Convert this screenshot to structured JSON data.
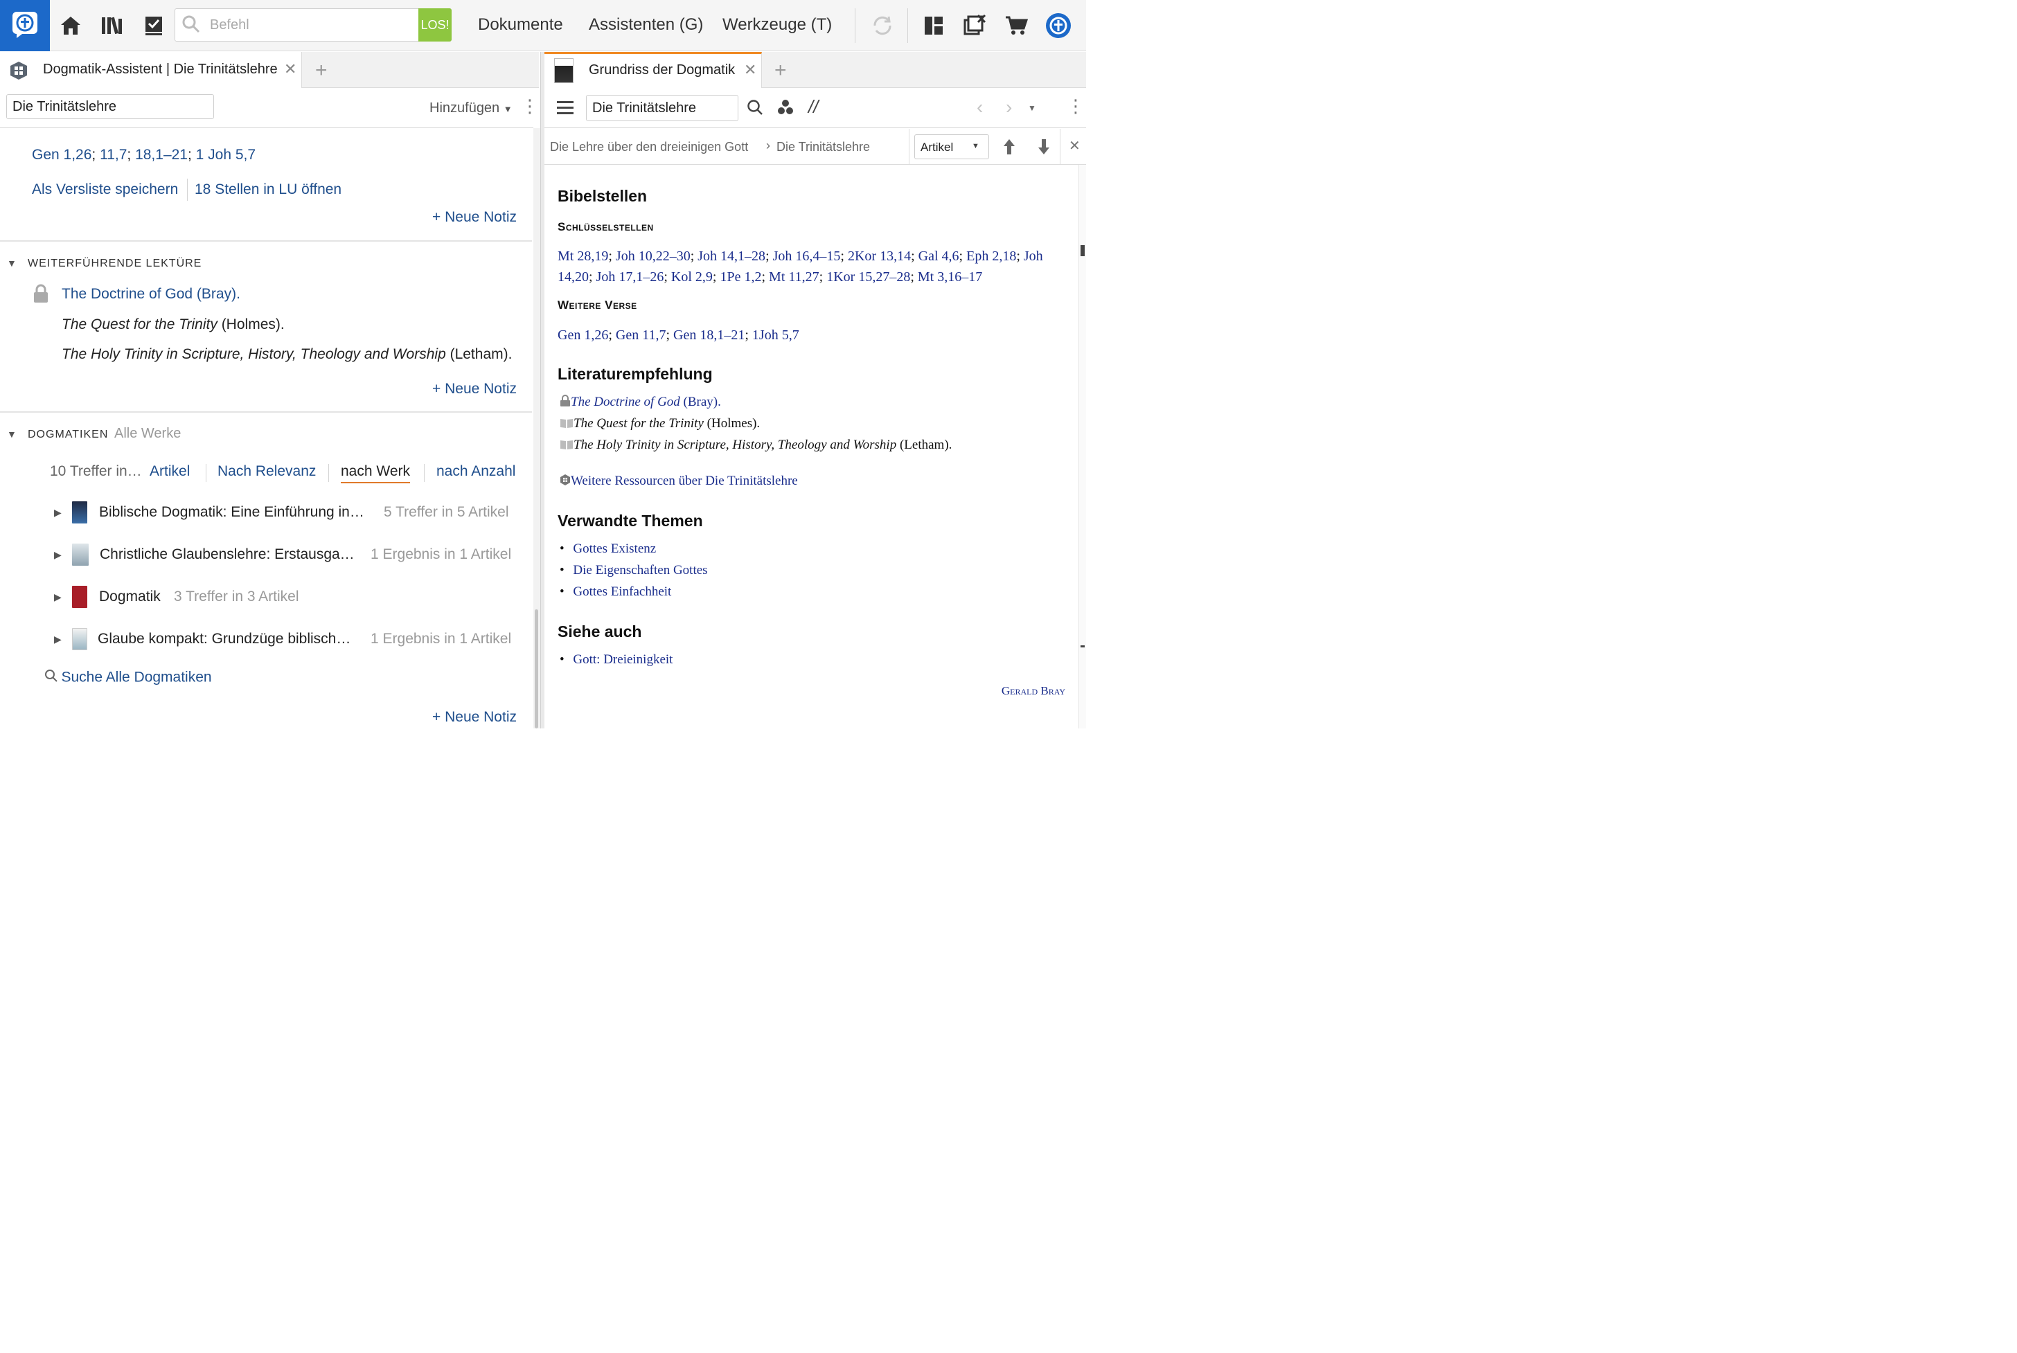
{
  "toolbar": {
    "command_placeholder": "Befehl",
    "go_label": "LOS!",
    "menu": [
      "Dokumente",
      "Assistenten (G)",
      "Werkzeuge (T)"
    ]
  },
  "left_tab": {
    "title": "Dogmatik-Assistent | Die Trinitätslehre"
  },
  "left_toolbar": {
    "topic_value": "Die Trinitätslehre",
    "add_label": "Hinzufügen"
  },
  "verses": {
    "refs": [
      "Gen 1,26",
      "11,7",
      "18,1–21",
      "1 Joh 5,7"
    ],
    "save_label": "Als Versliste speichern",
    "open_label": "18 Stellen in LU öffnen"
  },
  "new_note_label": "+ Neue Notiz",
  "reading": {
    "heading": "WEITERFÜHRENDE LEKTÜRE",
    "items": [
      {
        "title": "The Doctrine of God (Bray).",
        "locked": true
      },
      {
        "title": "The Quest for the Trinity",
        "author": " (Holmes)."
      },
      {
        "title": "The Holy Trinity in Scripture, History, Theology and Worship",
        "author": " (Letham)."
      }
    ]
  },
  "dogmatiken": {
    "heading": "DOGMATIKEN",
    "all_works": "Alle Werke",
    "hits_prefix": "10 Treffer in…",
    "sort_options": [
      "Artikel",
      "Nach Relevanz",
      "nach Werk",
      "nach Anzahl"
    ],
    "rows": [
      {
        "title": "Biblische Dogmatik: Eine Einführung in…",
        "count": "5 Treffer in 5 Artikel"
      },
      {
        "title": "Christliche Glaubenslehre: Erstausga…",
        "count": "1 Ergebnis in 1 Artikel"
      },
      {
        "title": "Dogmatik",
        "count": "3 Treffer in 3 Artikel"
      },
      {
        "title": "Glaube kompakt: Grundzüge biblisch…",
        "count": "1 Ergebnis in 1 Artikel"
      }
    ],
    "search_all": "Suche Alle Dogmatiken"
  },
  "right_tab": {
    "title": "Grundriss der Dogmatik"
  },
  "right_toolbar": {
    "topic_value": "Die Trinitätslehre",
    "parallel_label": "//"
  },
  "breadcrumb": {
    "parent": "Die Lehre über den dreieinigen Gott",
    "sep": "›",
    "current": "Die Trinitätslehre",
    "view_select": "Artikel"
  },
  "article": {
    "h_bible": "Bibelstellen",
    "h_key": "Schlüsselstellen",
    "key_refs": [
      "Mt 28,19",
      "Joh 10,22–30",
      "Joh 14,1–28",
      "Joh 16,4–15",
      "2Kor 13,14",
      "Gal 4,6",
      "Eph 2,18",
      "Joh 14,20",
      "Joh 17,1–26",
      "Kol 2,9",
      "1Pe 1,2",
      "Mt 11,27",
      "1Kor 15,27–28",
      "Mt 3,16–17"
    ],
    "h_more": "Weitere Verse",
    "more_refs": [
      "Gen 1,26",
      "Gen 11,7",
      "Gen 18,1–21",
      "1Joh 5,7"
    ],
    "h_lit": "Literaturempfehlung",
    "lit": [
      {
        "title": "The Doctrine of God",
        "author": " (Bray)."
      },
      {
        "title": "The Quest for the Trinity",
        "author": " (Holmes)."
      },
      {
        "title": "The Holy Trinity in Scripture, History, Theology and Worship",
        "author": " (Letham)."
      }
    ],
    "more_resources": "Weitere Ressourcen über Die Trinitätslehre",
    "h_related": "Verwandte Themen",
    "related": [
      "Gottes Existenz",
      "Die Eigenschaften Gottes",
      "Gottes Einfachheit"
    ],
    "h_see": "Siehe auch",
    "see": [
      "Gott: Dreieinigkeit"
    ],
    "author_sig": "Gerald Bray"
  },
  "colors": {
    "brand_blue": "#1c69c9",
    "go_green": "#8ec640",
    "link_blue": "#1f4e8c",
    "article_link": "#1a2d8c",
    "tab_accent": "#f08a24"
  }
}
